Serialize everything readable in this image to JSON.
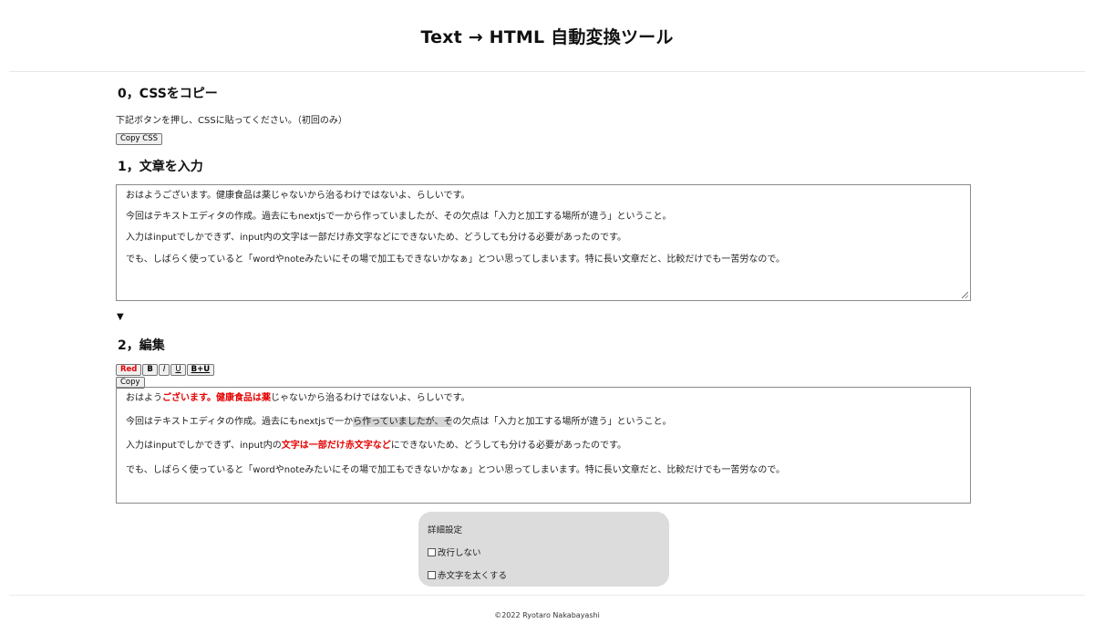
{
  "header": {
    "title": "Text → HTML 自動変換ツール"
  },
  "section0": {
    "title": "0，CSSをコピー",
    "description": "下記ボタンを押し、CSSに貼ってください。（初回のみ）",
    "copy_css_label": "Copy CSS"
  },
  "section1": {
    "title": "1，文章を入力",
    "lines": [
      "おはようございます。健康食品は薬じゃないから治るわけではないよ、らしいです。",
      "今回はテキストエディタの作成。過去にもnextjsで一から作っていましたが、その欠点は「入力と加工する場所が違う」ということ。",
      "入力はinputでしかできず、input内の文字は一部だけ赤文字などにできないため、どうしても分ける必要があったのです。",
      "でも、しばらく使っていると「wordやnoteみたいにその場で加工もできないかなぁ」とつい思ってしまいます。特に長い文章だと、比較だけでも一苦労なので。"
    ]
  },
  "arrow": "▼",
  "section2": {
    "title": "2，編集",
    "toolbar": {
      "red": "Red",
      "bold": "B",
      "italic": "I",
      "underline": "U",
      "bold_underline": "B+U",
      "copy": "Copy"
    },
    "line1": {
      "a": "おはよう",
      "b": "ございます。健康食品は薬",
      "c": "じゃないから治るわけではないよ、らしいです。"
    },
    "line2": {
      "a": "今回はテキストエディタの作成。過去にもnextjsで一か",
      "b": "ら作っていましたが、そ",
      "c": "の欠点は「入力と加工する場所が違う」ということ。"
    },
    "line3": {
      "a": "入力はinputでしかできず、input内の",
      "b": "文字は一部だけ赤文字など",
      "c": "にできないため、どうしても分ける必要があったのです。"
    },
    "line4": "でも、しばらく使っていると「wordやnoteみたいにその場で加工もできないかなぁ」とつい思ってしまいます。特に長い文章だと、比較だけでも一苦労なので。"
  },
  "settings": {
    "title": "詳細設定",
    "option_no_break": "改行しない",
    "option_bold_red": "赤文字を太くする"
  },
  "footer": {
    "copyright": "©2022 Ryotaro Nakabayashi"
  },
  "colors": {
    "accent_red": "#e60000",
    "panel_gray": "#dcdcdc",
    "highlight_gray": "#d6d6d6"
  }
}
